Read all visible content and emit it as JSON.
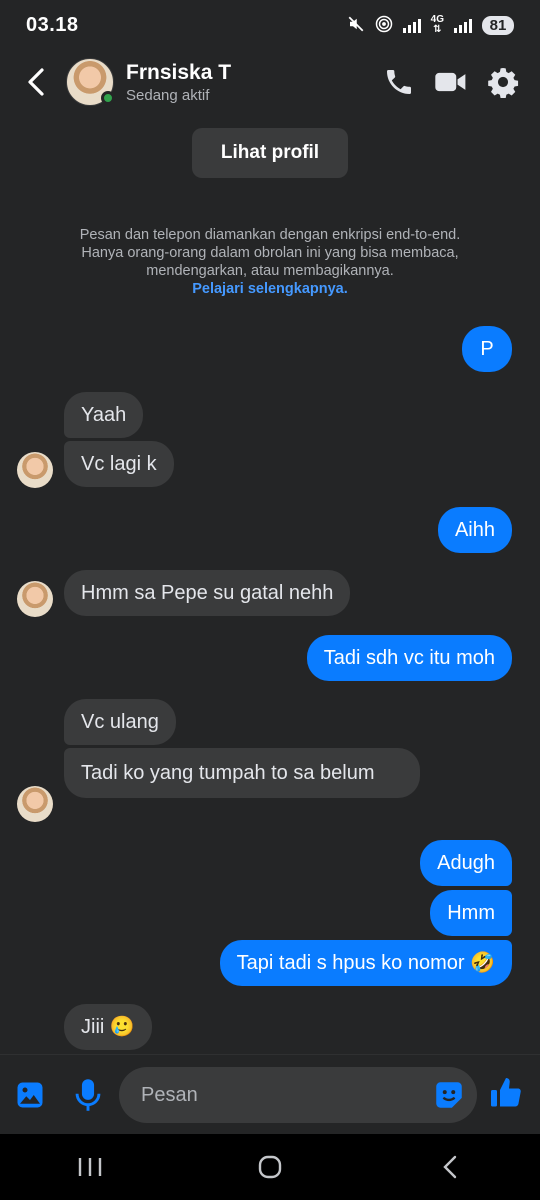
{
  "status_bar": {
    "time": "03.18",
    "network": "4G",
    "battery": "81"
  },
  "header": {
    "contact_name": "Frnsiska T",
    "contact_status": "Sedang aktif"
  },
  "chat": {
    "profile_button": "Lihat profil",
    "encryption_notice": "Pesan dan telepon diamankan dengan enkripsi end-to-end. Hanya orang-orang dalam obrolan ini yang bisa membaca, mendengarkan, atau membagikannya.",
    "learn_more": "Pelajari selengkapnya.",
    "messages": [
      {
        "from": "me",
        "text": "P"
      },
      {
        "from": "them",
        "text": "Yaah"
      },
      {
        "from": "them",
        "text": "Vc lagi k"
      },
      {
        "from": "me",
        "text": "Aihh"
      },
      {
        "from": "them",
        "text": "Hmm sa Pepe su gatal nehh"
      },
      {
        "from": "me",
        "text": "Tadi sdh vc itu moh"
      },
      {
        "from": "them",
        "text": "Vc ulang"
      },
      {
        "from": "them",
        "text": "Tadi ko yang tumpah to sa belum"
      },
      {
        "from": "me",
        "text": "Adugh"
      },
      {
        "from": "me",
        "text": "Hmm"
      },
      {
        "from": "me",
        "text": "Tapi tadi s hpus ko nomor 🤣"
      },
      {
        "from": "them",
        "text": "Jiii 🥲"
      }
    ]
  },
  "input": {
    "placeholder": "Pesan"
  },
  "colors": {
    "background": "#242526",
    "incoming_bubble": "#3a3b3c",
    "outgoing_bubble": "#0a7cff",
    "accent": "#0a7cff",
    "online": "#31a24c"
  }
}
